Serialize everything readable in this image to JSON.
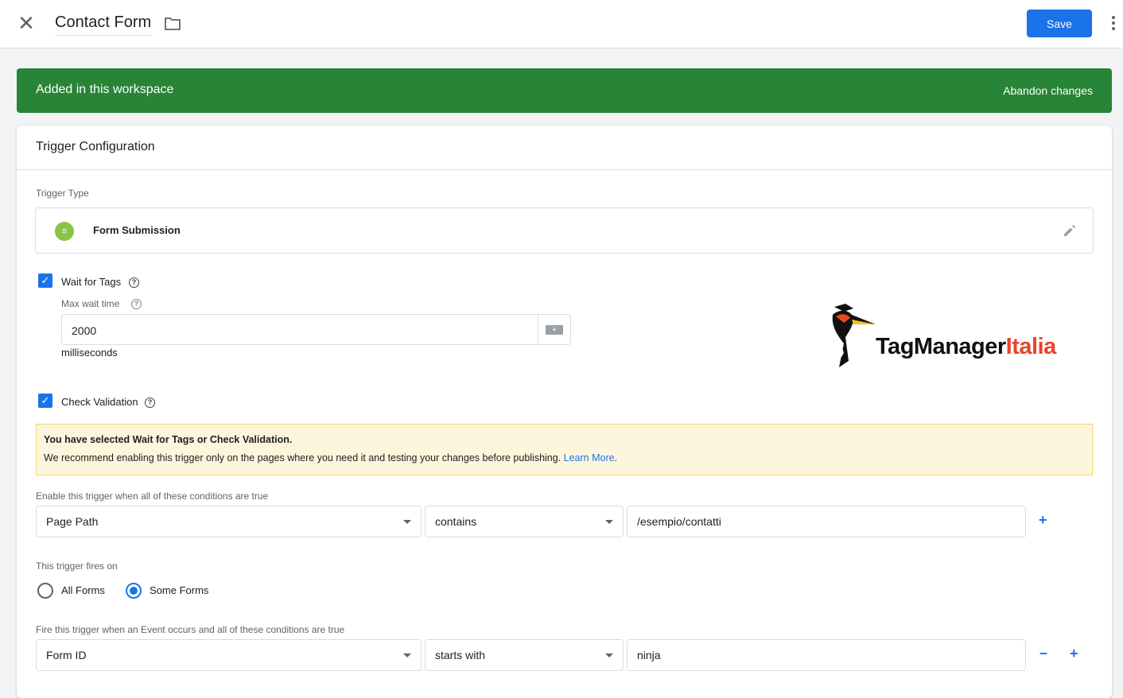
{
  "header": {
    "title": "Contact Form",
    "save_label": "Save"
  },
  "banner": {
    "text": "Added in this workspace",
    "abandon_label": "Abandon changes",
    "color": "#288437"
  },
  "card": {
    "title": "Trigger Configuration"
  },
  "trigger_type": {
    "label": "Trigger Type",
    "value": "Form Submission",
    "icon": "form-submission-icon"
  },
  "wait_for_tags": {
    "label": "Wait for Tags",
    "checked": true,
    "max_wait_label": "Max wait time",
    "value": "2000",
    "unit": "milliseconds"
  },
  "check_validation": {
    "label": "Check Validation",
    "checked": true
  },
  "warning": {
    "title": "You have selected Wait for Tags or Check Validation.",
    "body": "We recommend enabling this trigger only on the pages where you need it and testing your changes before publishing. ",
    "link": "Learn More",
    "end": "."
  },
  "enable_conditions": {
    "label": "Enable this trigger when all of these conditions are true",
    "variable": "Page Path",
    "operator": "contains",
    "value": "/esempio/contatti"
  },
  "fires_on": {
    "label": "This trigger fires on",
    "options": [
      {
        "label": "All Forms",
        "selected": false
      },
      {
        "label": "Some Forms",
        "selected": true
      }
    ]
  },
  "fire_conditions": {
    "label": "Fire this trigger when an Event occurs and all of these conditions are true",
    "variable": "Form ID",
    "operator": "starts with",
    "value": "ninja"
  },
  "logo": {
    "text_black": "TagManager",
    "text_red": "Italia"
  },
  "accent": "#1a73e8"
}
